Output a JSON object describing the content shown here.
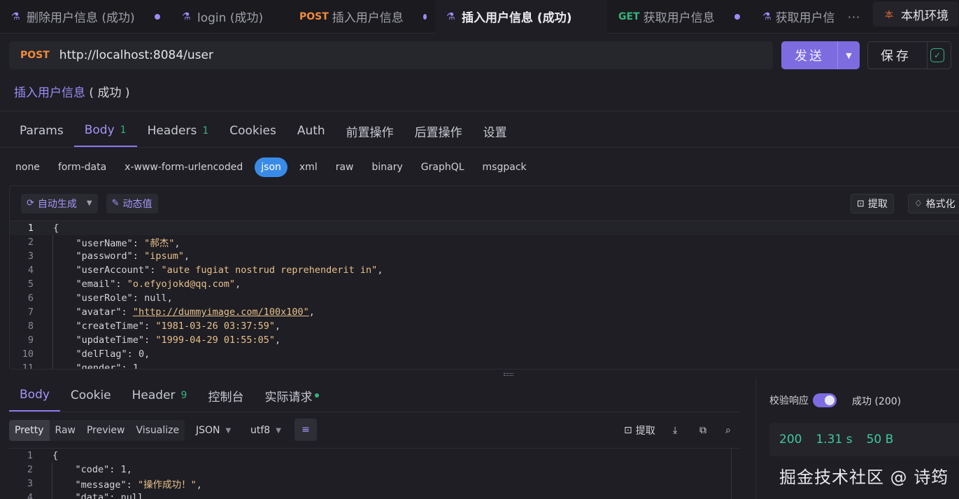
{
  "tabs": [
    {
      "method": "",
      "label": "删除用户信息 (成功)",
      "active": false,
      "dot": true
    },
    {
      "method": "",
      "label": "login (成功)",
      "active": false,
      "dot": false
    },
    {
      "method": "POST",
      "label": "插入用户信息",
      "active": false,
      "dot": true
    },
    {
      "method": "",
      "label": "插入用户信息 (成功)",
      "active": true,
      "dot": false
    },
    {
      "method": "GET",
      "label": "获取用户信息",
      "active": false,
      "dot": true
    },
    {
      "method": "",
      "label": "获取用户信",
      "active": false,
      "dot": false
    }
  ],
  "tab_more": "···",
  "env": {
    "icon": "本",
    "label": "本机环境"
  },
  "request": {
    "method": "POST",
    "url": "http://localhost:8084/user",
    "send_label": "发送",
    "save_label": "保存",
    "title": "插入用户信息",
    "title_suffix": " ( 成功 )"
  },
  "req_tabs": [
    {
      "label": "Params",
      "count": ""
    },
    {
      "label": "Body",
      "count": "1"
    },
    {
      "label": "Headers",
      "count": "1"
    },
    {
      "label": "Cookies",
      "count": ""
    },
    {
      "label": "Auth",
      "count": ""
    },
    {
      "label": "前置操作",
      "count": ""
    },
    {
      "label": "后置操作",
      "count": ""
    },
    {
      "label": "设置",
      "count": ""
    }
  ],
  "body_types": [
    "none",
    "form-data",
    "x-www-form-urlencoded",
    "json",
    "xml",
    "raw",
    "binary",
    "GraphQL",
    "msgpack"
  ],
  "editor_toolbar": {
    "auto_generate": "自动生成",
    "dynamic_value": "动态值",
    "extract": "提取",
    "format": "格式化"
  },
  "request_body_lines": [
    {
      "n": "1",
      "key": "",
      "val": "{",
      "type": "plain"
    },
    {
      "n": "2",
      "key": "\"userName\"",
      "val": "\"郝杰\"",
      "type": "s",
      "comma": ","
    },
    {
      "n": "3",
      "key": "\"password\"",
      "val": "\"ipsum\"",
      "type": "s",
      "comma": ","
    },
    {
      "n": "4",
      "key": "\"userAccount\"",
      "val": "\"aute fugiat nostrud reprehenderit in\"",
      "type": "s",
      "comma": ","
    },
    {
      "n": "5",
      "key": "\"email\"",
      "val": "\"o.efyojokd@qq.com\"",
      "type": "s",
      "comma": ","
    },
    {
      "n": "6",
      "key": "\"userRole\"",
      "val": "null",
      "type": "n",
      "comma": ","
    },
    {
      "n": "7",
      "key": "\"avatar\"",
      "val": "\"http://dummyimage.com/100x100\"",
      "type": "u",
      "comma": ","
    },
    {
      "n": "8",
      "key": "\"createTime\"",
      "val": "\"1981-03-26 03:37:59\"",
      "type": "s",
      "comma": ","
    },
    {
      "n": "9",
      "key": "\"updateTime\"",
      "val": "\"1999-04-29 01:55:05\"",
      "type": "s",
      "comma": ","
    },
    {
      "n": "10",
      "key": "\"delFlag\"",
      "val": "0",
      "type": "n",
      "comma": ","
    },
    {
      "n": "11",
      "key": "\"gender\"",
      "val": "1",
      "type": "n",
      "comma": ""
    }
  ],
  "resp_tabs": [
    {
      "label": "Body",
      "count": ""
    },
    {
      "label": "Cookie",
      "count": ""
    },
    {
      "label": "Header",
      "count": "9"
    },
    {
      "label": "控制台",
      "count": ""
    },
    {
      "label": "实际请求",
      "count": ""
    }
  ],
  "resp_views": [
    "Pretty",
    "Raw",
    "Preview",
    "Visualize"
  ],
  "resp_format": "JSON",
  "resp_encoding": "utf8",
  "resp_extract": "提取",
  "response_lines": [
    {
      "n": "1",
      "key": "",
      "val": "{",
      "type": "plain"
    },
    {
      "n": "2",
      "key": "\"code\"",
      "val": "1",
      "type": "n",
      "comma": ","
    },
    {
      "n": "3",
      "key": "\"message\"",
      "val": "\"操作成功！\"",
      "type": "s",
      "comma": ","
    },
    {
      "n": "4",
      "key": "\"data\"",
      "val": "null",
      "type": "n",
      "comma": ""
    }
  ],
  "validate_label": "校验响应",
  "status": "成功 (200)",
  "stats": {
    "code": "200",
    "time": "1.31 s",
    "size": "50 B"
  },
  "watermark": "掘金技术社区 @ 诗筠",
  "colors": {
    "accent": "#7d6be0",
    "success": "#36b37e",
    "post": "#f28b3a",
    "get": "#36b37e"
  }
}
